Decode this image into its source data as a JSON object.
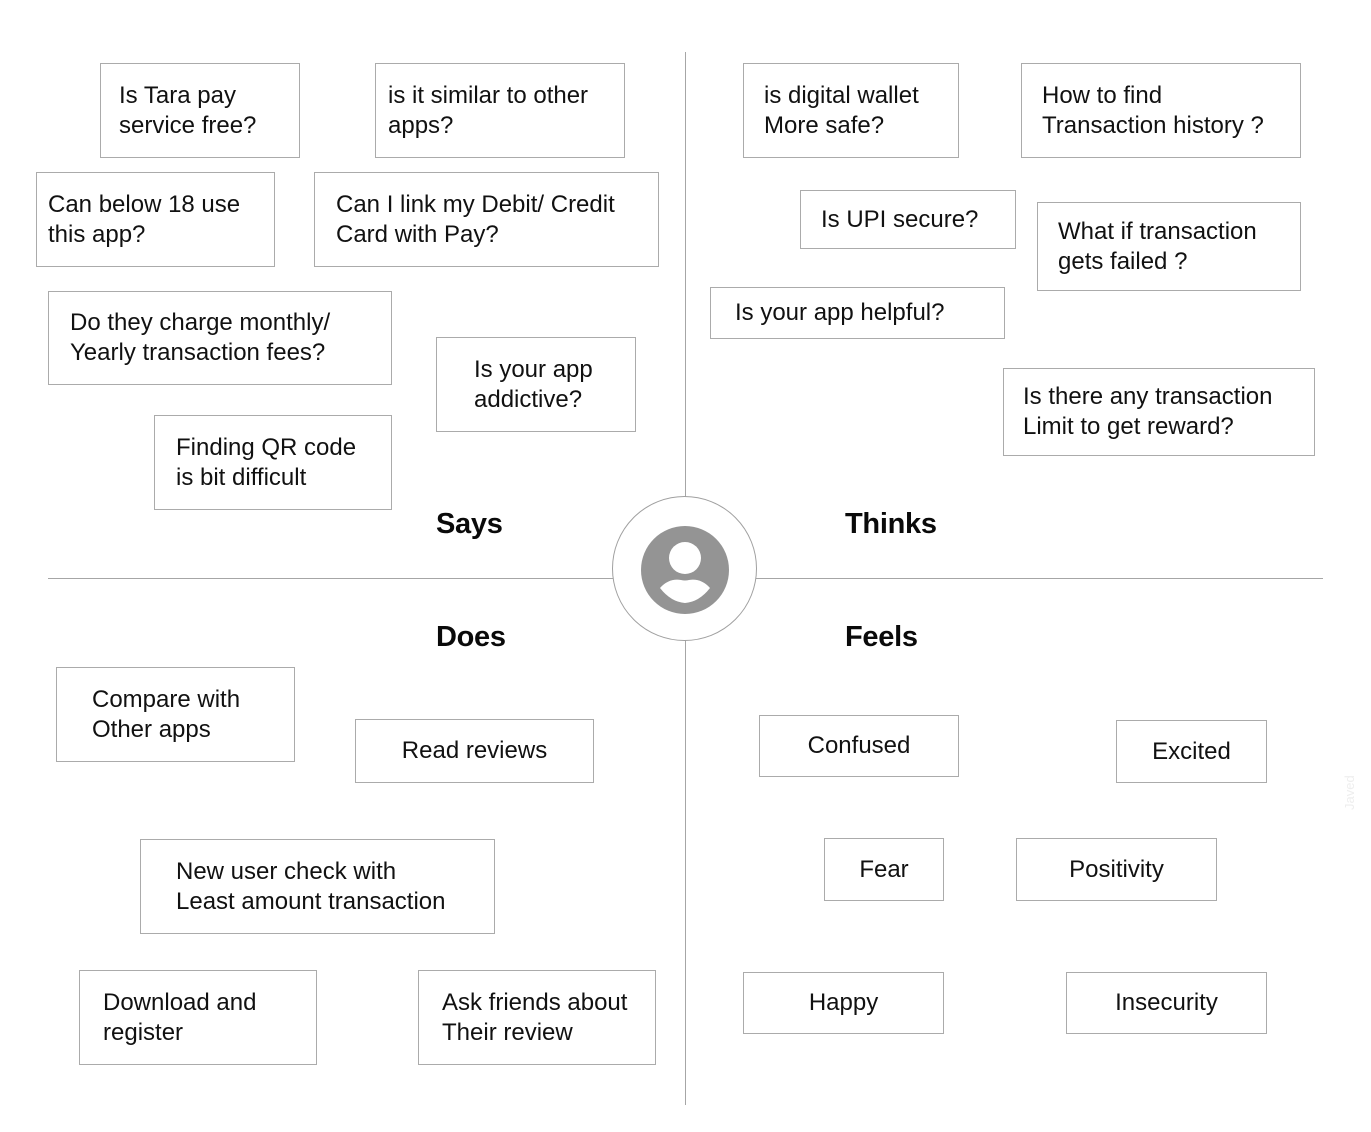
{
  "quadrants": {
    "says": {
      "label": "Says",
      "notes": [
        "Is Tara pay\nservice free?",
        "is it similar to other\napps?",
        "Can below 18 use\nthis app?",
        "Can I link my Debit/ Credit\nCard with Pay?",
        "Do they charge monthly/\nYearly transaction fees?",
        "Is your app\naddictive?",
        "Finding QR code\nis bit difficult"
      ]
    },
    "thinks": {
      "label": "Thinks",
      "notes": [
        "is digital wallet\nMore safe?",
        "How to find\nTransaction history ?",
        "Is UPI secure?",
        "What if transaction\ngets failed ?",
        "Is your app helpful?",
        "Is there any transaction\nLimit to get reward?"
      ]
    },
    "does": {
      "label": "Does",
      "notes": [
        "Compare with\nOther apps",
        "Read reviews",
        "New user check with\nLeast amount transaction",
        "Download and\nregister",
        "Ask friends about\nTheir review"
      ]
    },
    "feels": {
      "label": "Feels",
      "notes": [
        "Confused",
        "Excited",
        "Fear",
        "Positivity",
        "Happy",
        "Insecurity"
      ]
    }
  },
  "center": {
    "icon": "user-avatar-icon"
  },
  "colors": {
    "line": "#a6a6a6",
    "note_border": "#ababab",
    "avatar_fill": "#949494",
    "text": "#111111"
  },
  "watermark": "Javed"
}
